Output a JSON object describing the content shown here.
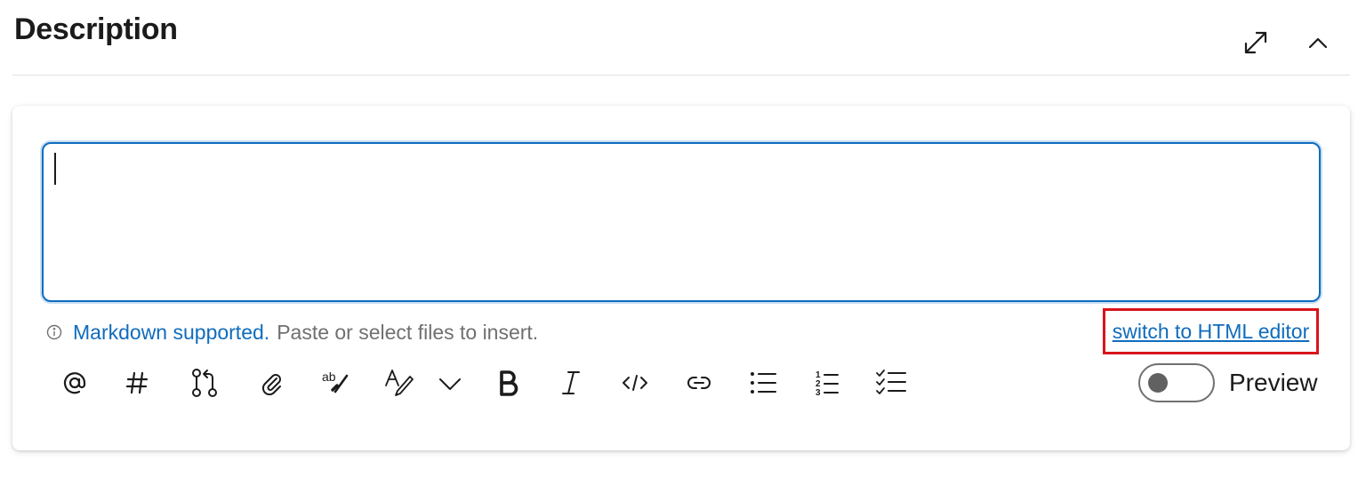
{
  "header": {
    "title": "Description",
    "expand_icon": "expand-diagonal-icon",
    "collapse_icon": "chevron-up-icon"
  },
  "editor": {
    "value": "",
    "focused": true,
    "accent_color": "#0f6cbd"
  },
  "hint": {
    "info_icon": "info-icon",
    "markdown_link": "Markdown supported.",
    "text": "Paste or select files to insert."
  },
  "switch_editor": {
    "label": "switch to HTML editor",
    "highlight_color": "#d9141c"
  },
  "toolbar": {
    "items": [
      {
        "name": "mention",
        "icon": "at-icon"
      },
      {
        "name": "work-item",
        "icon": "hash-icon"
      },
      {
        "name": "pull-request",
        "icon": "pull-request-icon"
      },
      {
        "name": "attach",
        "icon": "paperclip-icon"
      },
      {
        "name": "spell-check",
        "icon": "spell-check-icon"
      },
      {
        "name": "format",
        "icon": "text-format-icon"
      },
      {
        "name": "more-formatting",
        "icon": "chevron-down-icon"
      },
      {
        "name": "bold",
        "icon": "bold-icon"
      },
      {
        "name": "italic",
        "icon": "italic-icon"
      },
      {
        "name": "code",
        "icon": "code-icon"
      },
      {
        "name": "link",
        "icon": "link-icon"
      },
      {
        "name": "bulleted-list",
        "icon": "bulleted-list-icon"
      },
      {
        "name": "numbered-list",
        "icon": "numbered-list-icon"
      },
      {
        "name": "checklist",
        "icon": "checklist-icon"
      }
    ]
  },
  "preview": {
    "label": "Preview",
    "enabled": false
  }
}
